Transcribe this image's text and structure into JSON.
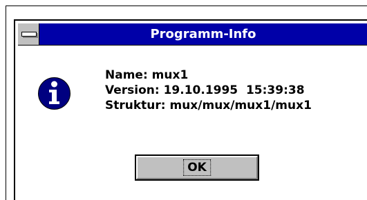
{
  "dialog": {
    "title": "Programm-Info",
    "icon": "information-icon",
    "lines": [
      "Name: mux1",
      "Version: 19.10.1995  15:39:38",
      "Struktur: mux/mux/mux1/mux1"
    ],
    "ok_label": "OK"
  },
  "colors": {
    "titlebar": "#0000a8",
    "button_face": "#c0c0c0",
    "icon_fill": "#000080"
  }
}
